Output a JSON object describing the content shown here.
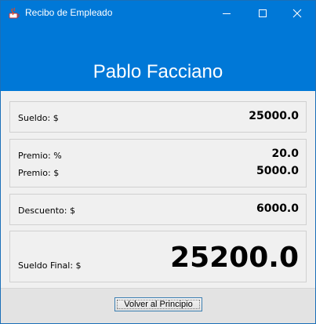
{
  "window": {
    "title": "Recibo de Empleado",
    "app_icon": "java-icon",
    "controls": [
      "minimize-icon",
      "maximize-icon",
      "close-icon"
    ]
  },
  "header": {
    "employee_name": "Pablo Facciano",
    "background": "#0078d7"
  },
  "panels": {
    "salary": {
      "label": "Sueldo: $",
      "value": "25000.0"
    },
    "bonus_percent": {
      "label": "Premio: %",
      "value": "20.0"
    },
    "bonus_amount": {
      "label": "Premio: $",
      "value": "5000.0"
    },
    "discount": {
      "label": "Descuento: $",
      "value": "6000.0"
    },
    "final_salary": {
      "label": "Sueldo Final: $",
      "value": "25200.0"
    }
  },
  "footer": {
    "back_button_label": "Volver al Principio"
  }
}
